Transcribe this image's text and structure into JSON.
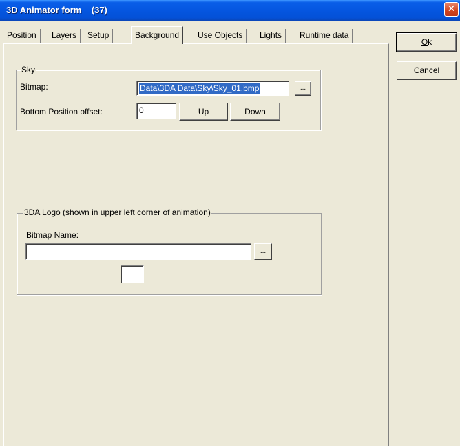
{
  "window": {
    "title": "3D Animator form    (37)",
    "close_glyph": "✕"
  },
  "tabs": [
    {
      "label": "Position",
      "active": false
    },
    {
      "label": "Layers",
      "active": false
    },
    {
      "label": "Setup",
      "active": false
    },
    {
      "label": "Background",
      "active": true
    },
    {
      "label": "Use Objects",
      "active": false
    },
    {
      "label": "Lights",
      "active": false
    },
    {
      "label": "Runtime data",
      "active": false
    }
  ],
  "buttons": {
    "ok": {
      "mnemonic": "O",
      "rest": "k"
    },
    "cancel": {
      "mnemonic": "C",
      "rest": "ancel"
    }
  },
  "sky": {
    "group_title": "Sky",
    "bitmap_label": "Bitmap:",
    "bitmap_value": "Data\\3DA Data\\Sky\\Sky_01.bmp",
    "browse_label": "...",
    "offset_label": "Bottom Position offset:",
    "offset_value": "0",
    "up_label": "Up",
    "down_label": "Down"
  },
  "logo": {
    "group_title": "3DA Logo (shown in upper left corner of animation)",
    "bitmap_name_label": "Bitmap Name:",
    "bitmap_name_value": "",
    "browse_label": "...",
    "preview_value": ""
  },
  "colors": {
    "titlebar": "#0556e0",
    "dialog_bg": "#ece9d8",
    "selection": "#316ac5",
    "close_button": "#d2441e"
  }
}
